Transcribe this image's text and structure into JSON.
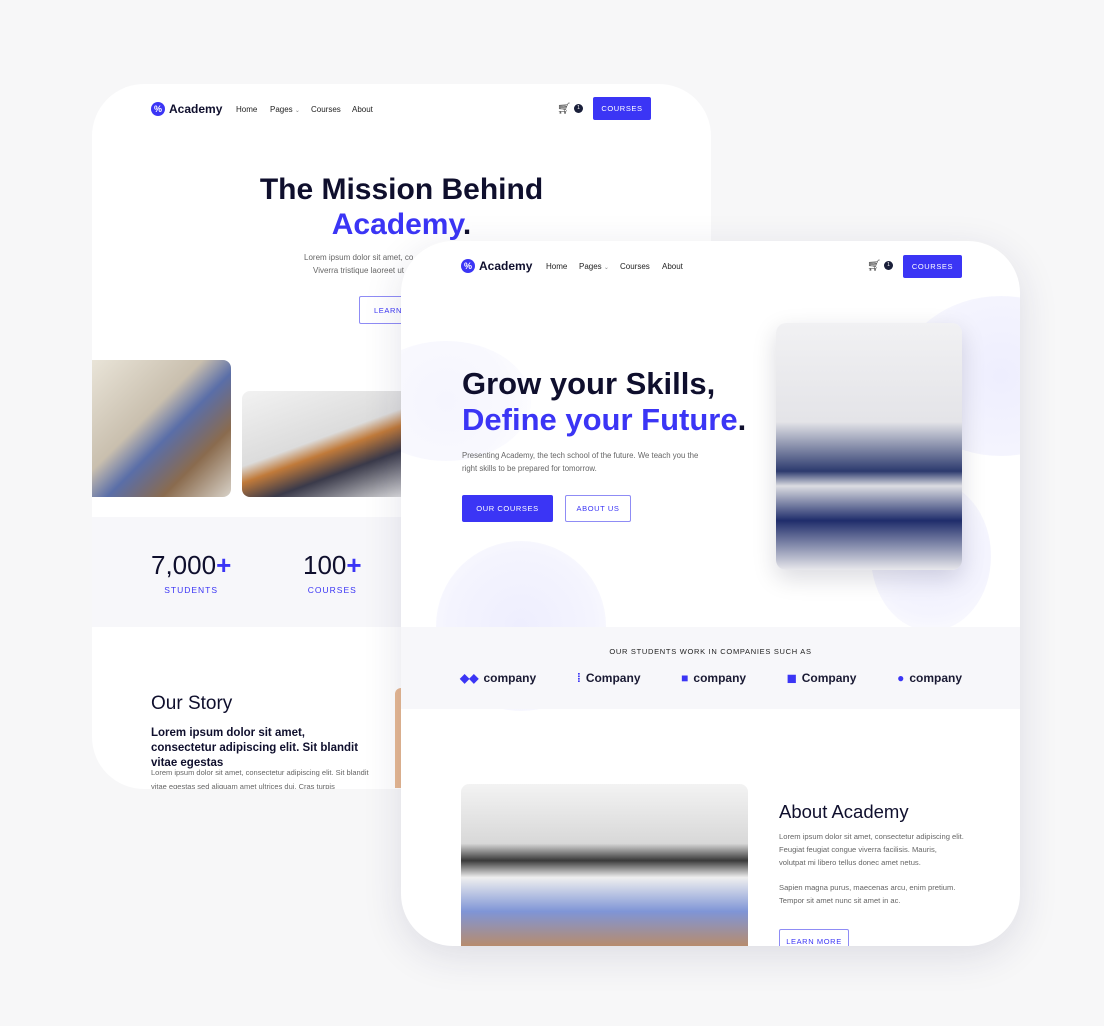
{
  "colors": {
    "accent": "#3b35f5",
    "dark": "#0f0f2d",
    "band": "#f7f7fa"
  },
  "back": {
    "logo": "Academy",
    "nav": [
      "Home",
      "Pages",
      "Courses",
      "About"
    ],
    "cart_count": "1",
    "cta": "COURSES",
    "title_line1": "The Mission Behind",
    "title_accent": "Academy",
    "title_dot": ".",
    "intro_line1": "Lorem ipsum dolor sit amet, co",
    "intro_line2": "Viverra tristique laoreet ut",
    "learn": "LEARN",
    "stats": [
      {
        "value": "7,000",
        "plus": "+",
        "label": "STUDENTS"
      },
      {
        "value": "100",
        "plus": "+",
        "label": "COURSES"
      }
    ],
    "story_title": "Our Story",
    "story_sub": "Lorem ipsum dolor sit amet, consectetur adipiscing elit. Sit blandit vitae egestas",
    "story_body": "Lorem ipsum dolor sit amet, consectetur adipiscing elit. Sit blandit vitae egestas sed aliquam amet ultrices dui. Cras turpis"
  },
  "front": {
    "logo": "Academy",
    "nav": [
      "Home",
      "Pages",
      "Courses",
      "About"
    ],
    "cart_count": "1",
    "cta": "COURSES",
    "title_line1": "Grow your Skills,",
    "title_accent": "Define your Future",
    "title_dot": ".",
    "intro": "Presenting Academy, the tech school of the future. We teach you the right skills to be prepared for tomorrow.",
    "btn_primary": "OUR COURSES",
    "btn_secondary": "ABOUT US",
    "companies_title": "OUR STUDENTS WORK IN COMPANIES SUCH AS",
    "companies": [
      {
        "name": "company",
        "icon": "diamonds-icon"
      },
      {
        "name": "Company",
        "icon": "dots-icon"
      },
      {
        "name": "company",
        "icon": "square-dot-icon"
      },
      {
        "name": "Company",
        "icon": "layers-icon"
      },
      {
        "name": "company",
        "icon": "ring-icon"
      }
    ],
    "about_title": "About Academy",
    "about_p1": "Lorem ipsum dolor sit amet, consectetur adipiscing elit. Feugiat feugiat congue viverra facilisis. Mauris, volutpat mi libero tellus donec amet netus.",
    "about_p2": "Sapien magna purus, maecenas arcu, enim pretium. Tempor sit amet nunc sit amet in ac.",
    "about_btn": "LEARN MORE"
  }
}
